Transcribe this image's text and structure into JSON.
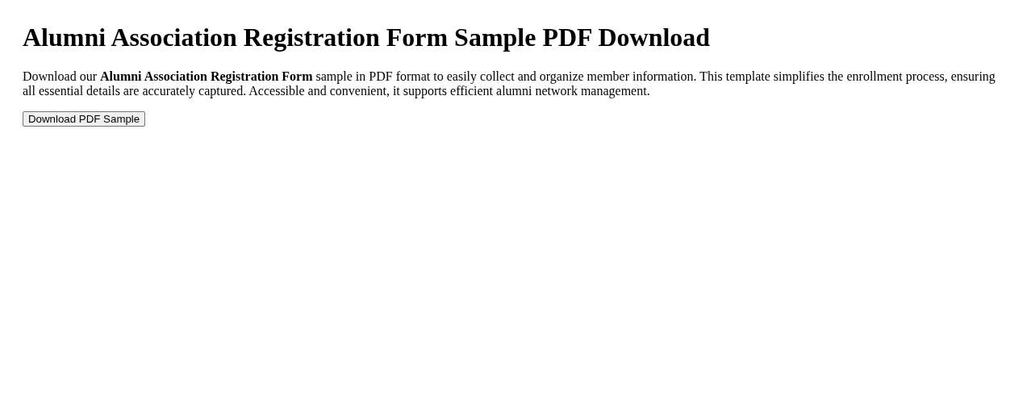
{
  "title": "Alumni Association Registration Form Sample PDF Download",
  "description": "Download our **Alumni Association Registration Form** sample in PDF format to easily collect and organize member information. This template simplifies the enrollment process, ensuring all essential details are accurately captured. Accessible and convenient, it supports efficient alumni network management.",
  "button": "Download PDF Sample"
}
